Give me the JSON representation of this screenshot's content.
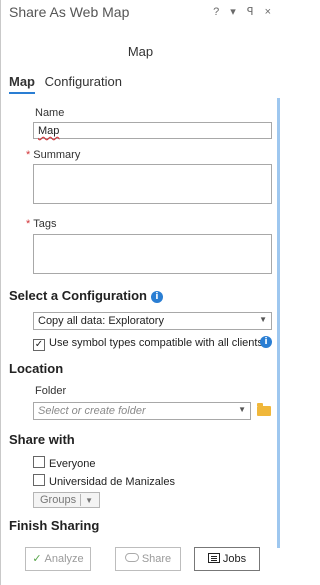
{
  "window": {
    "title": "Share As Web Map",
    "controls": "? ▾ ꟼ ×"
  },
  "subtitle": "Map",
  "tabs": [
    {
      "label": "Map"
    },
    {
      "label": "Configuration"
    }
  ],
  "fields": {
    "name_label": "Name",
    "name_value": "Map",
    "summary_label": "Summary",
    "summary_value": "",
    "tags_label": "Tags",
    "tags_value": ""
  },
  "configuration": {
    "heading": "Select a Configuration",
    "selected": "Copy all data: Exploratory",
    "symbol_checkbox_label": "Use symbol types compatible with all clients",
    "symbol_checked": true
  },
  "location": {
    "heading": "Location",
    "folder_label": "Folder",
    "folder_placeholder": "Select or create folder"
  },
  "share_with": {
    "heading": "Share with",
    "options": [
      {
        "label": "Everyone",
        "checked": false
      },
      {
        "label": "Universidad de Manizales",
        "checked": false
      }
    ],
    "groups_label": "Groups"
  },
  "finish": {
    "heading": "Finish Sharing",
    "analyze_label": "Analyze",
    "share_label": "Share",
    "jobs_label": "Jobs"
  },
  "colors": {
    "accent": "#2a7ed3",
    "required": "#d13438",
    "analyze_check": "#57a64a",
    "folder": "#f0b73a"
  },
  "icons": [
    "info-icon",
    "folder-icon",
    "check-icon",
    "cloud-icon",
    "jobs-icon",
    "chevron-down-icon"
  ]
}
